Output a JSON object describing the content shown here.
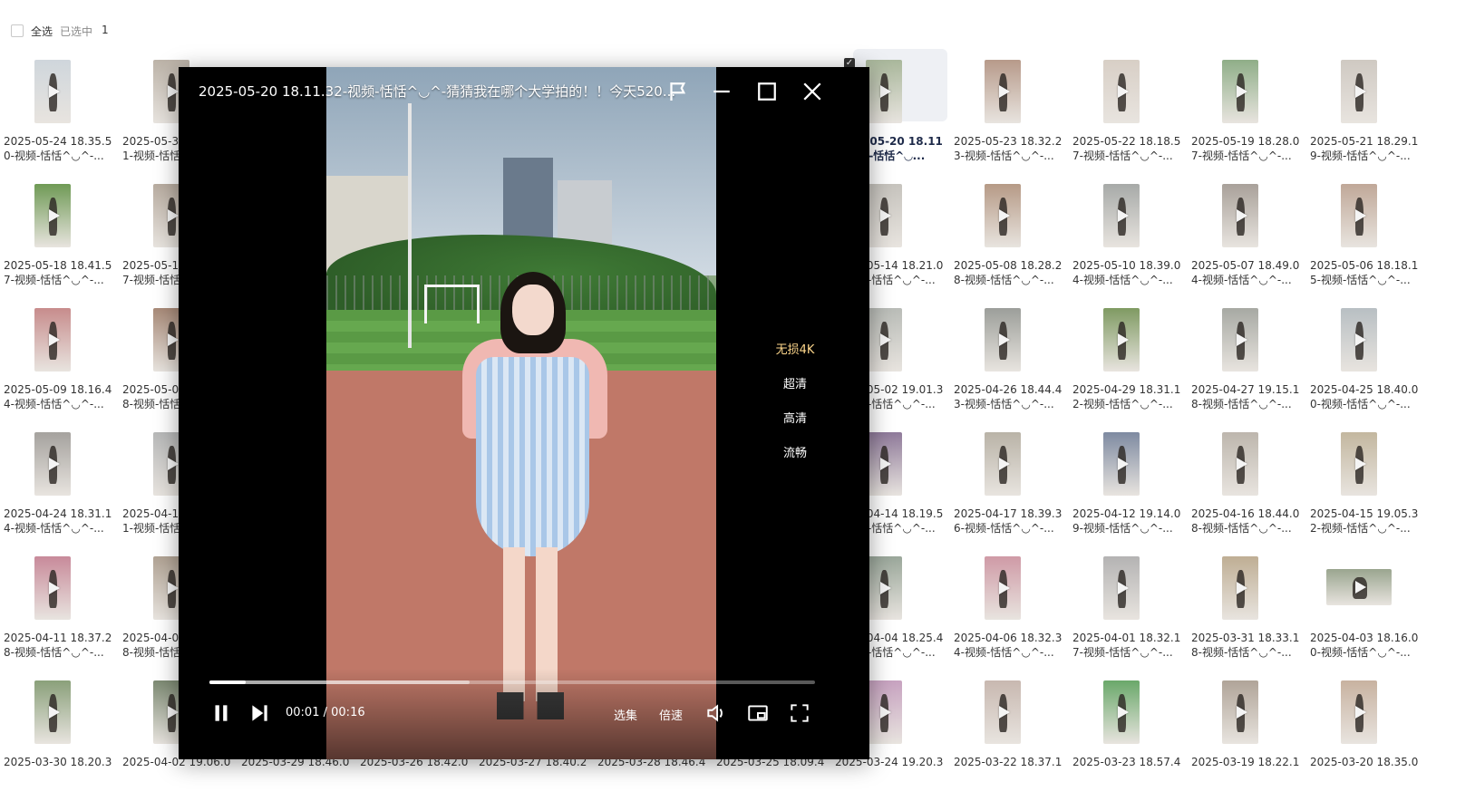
{
  "toolbar": {
    "select_all": "全选",
    "selected_label": "已选中",
    "selected_count": "1"
  },
  "player": {
    "title": "2025-05-20 18.11.32-视频-恬恬^◡^-猜猜我在哪个大学拍的！！今天520...",
    "quality_options": [
      "无损4K",
      "超清",
      "高清",
      "流畅"
    ],
    "active_quality": "无损4K",
    "time_current": "00:01",
    "time_separator": "/",
    "time_total": "00:16",
    "episodes_label": "选集",
    "speed_label": "倍速",
    "progress": 0.06,
    "buffered": 0.43
  },
  "grid": {
    "rows": [
      [
        {
          "l1": "2025-05-24 18.35.5",
          "l2": "0-视频-恬恬^◡^-...",
          "tone": "#cfd6dc"
        },
        {
          "l1": "2025-05-3",
          "l2": "1-视频-恬恬^◡^-...",
          "tone": "#bcb3a8"
        },
        null,
        null,
        null,
        null,
        null,
        {
          "l1": "2025-05-20 18.11.",
          "l2": "2-视频-恬恬^◡...",
          "tone": "#a9b79b",
          "selected": true
        },
        {
          "l1": "2025-05-23 18.32.2",
          "l2": "3-视频-恬恬^◡^-...",
          "tone": "#b79a8a"
        },
        {
          "l1": "2025-05-22 18.18.5",
          "l2": "7-视频-恬恬^◡^-...",
          "tone": "#d8cfc6"
        },
        {
          "l1": "2025-05-19 18.28.0",
          "l2": "7-视频-恬恬^◡^-...",
          "tone": "#8fae88"
        },
        {
          "l1": "2025-05-21 18.29.1",
          "l2": "9-视频-恬恬^◡^-...",
          "tone": "#cfc9c2"
        }
      ],
      [
        {
          "l1": "2025-05-18 18.41.5",
          "l2": "7-视频-恬恬^◡^-...",
          "tone": "#6f9a55"
        },
        {
          "l1": "2025-05-1",
          "l2": "7-视频-恬恬^◡^-...",
          "tone": "#b8aca0"
        },
        null,
        null,
        null,
        null,
        null,
        {
          "l1": "2025-05-14 18.21.0",
          "l2": "4-视频-恬恬^◡^-...",
          "tone": "#c6c3bd"
        },
        {
          "l1": "2025-05-08 18.28.2",
          "l2": "8-视频-恬恬^◡^-...",
          "tone": "#b69a86"
        },
        {
          "l1": "2025-05-10 18.39.0",
          "l2": "4-视频-恬恬^◡^-...",
          "tone": "#a7aaa8"
        },
        {
          "l1": "2025-05-07 18.49.0",
          "l2": "4-视频-恬恬^◡^-...",
          "tone": "#a9a19a"
        },
        {
          "l1": "2025-05-06 18.18.1",
          "l2": "5-视频-恬恬^◡^-...",
          "tone": "#c0a898"
        }
      ],
      [
        {
          "l1": "2025-05-09 18.16.4",
          "l2": "4-视频-恬恬^◡^-...",
          "tone": "#c78c8c"
        },
        {
          "l1": "2025-05-0",
          "l2": "8-视频-恬恬^◡^-...",
          "tone": "#a88a78"
        },
        null,
        null,
        null,
        null,
        null,
        {
          "l1": "2025-05-02 19.01.3",
          "l2": "1-视频-恬恬^◡^-...",
          "tone": "#b9bcb7"
        },
        {
          "l1": "2025-04-26 18.44.4",
          "l2": "3-视频-恬恬^◡^-...",
          "tone": "#9c9e9a"
        },
        {
          "l1": "2025-04-29 18.31.1",
          "l2": "2-视频-恬恬^◡^-...",
          "tone": "#7f9a62"
        },
        {
          "l1": "2025-04-27 19.15.1",
          "l2": "8-视频-恬恬^◡^-...",
          "tone": "#a7a9a3"
        },
        {
          "l1": "2025-04-25 18.40.0",
          "l2": "0-视频-恬恬^◡^-...",
          "tone": "#b8bfc3"
        }
      ],
      [
        {
          "l1": "2025-04-24 18.31.1",
          "l2": "4-视频-恬恬^◡^-...",
          "tone": "#a5a29e"
        },
        {
          "l1": "2025-04-1",
          "l2": "1-视频-恬恬^◡^-...",
          "tone": "#b7b8b8"
        },
        null,
        null,
        null,
        null,
        null,
        {
          "l1": "2025-04-14 18.19.5",
          "l2": "8-视频-恬恬^◡^-...",
          "tone": "#8f7a9a"
        },
        {
          "l1": "2025-04-17 18.39.3",
          "l2": "6-视频-恬恬^◡^-...",
          "tone": "#b9b3a7"
        },
        {
          "l1": "2025-04-12 19.14.0",
          "l2": "9-视频-恬恬^◡^-...",
          "tone": "#7e8aa1"
        },
        {
          "l1": "2025-04-16 18.44.0",
          "l2": "8-视频-恬恬^◡^-...",
          "tone": "#bdb6ad"
        },
        {
          "l1": "2025-04-15 19.05.3",
          "l2": "2-视频-恬恬^◡^-...",
          "tone": "#c3b79f"
        }
      ],
      [
        {
          "l1": "2025-04-11 18.37.2",
          "l2": "8-视频-恬恬^◡^-...",
          "tone": "#c88a9a"
        },
        {
          "l1": "2025-04-0",
          "l2": "8-视频-恬恬^◡^-...",
          "tone": "#b1a394"
        },
        null,
        null,
        null,
        null,
        null,
        {
          "l1": "2025-04-04 18.25.4",
          "l2": "4-视频-恬恬^◡^-...",
          "tone": "#9aa79a"
        },
        {
          "l1": "2025-04-06 18.32.3",
          "l2": "4-视频-恬恬^◡^-...",
          "tone": "#cf9aa6"
        },
        {
          "l1": "2025-04-01 18.32.1",
          "l2": "7-视频-恬恬^◡^-...",
          "tone": "#b4b3b3"
        },
        {
          "l1": "2025-03-31 18.33.1",
          "l2": "8-视频-恬恬^◡^-...",
          "tone": "#bfae94"
        },
        {
          "l1": "2025-04-03 18.16.0",
          "l2": "0-视频-恬恬^◡^-...",
          "tone": "#9aa58f",
          "wide": true
        }
      ],
      [
        {
          "l1": "2025-03-30 18.20.3",
          "l2": "",
          "tone": "#8aa07a"
        },
        {
          "l1": "2025-04-02 19.06.0",
          "l2": "",
          "tone": "#7d8a73"
        },
        {
          "l1": "2025-03-29 18.46.0",
          "l2": "",
          "tone": "#999"
        },
        {
          "l1": "2025-03-26 18.42.0",
          "l2": "",
          "tone": "#999"
        },
        {
          "l1": "2025-03-27 18.40.2",
          "l2": "",
          "tone": "#999"
        },
        {
          "l1": "2025-03-28 18.46.4",
          "l2": "",
          "tone": "#999"
        },
        {
          "l1": "2025-03-25 18.09.4",
          "l2": "",
          "tone": "#999"
        },
        {
          "l1": "2025-03-24 19.20.3",
          "l2": "",
          "tone": "#c7a2c0"
        },
        {
          "l1": "2025-03-22 18.37.1",
          "l2": "",
          "tone": "#c8b8b0"
        },
        {
          "l1": "2025-03-23 18.57.4",
          "l2": "",
          "tone": "#6aa86a"
        },
        {
          "l1": "2025-03-19 18.22.1",
          "l2": "",
          "tone": "#b0a498"
        },
        {
          "l1": "2025-03-20 18.35.0",
          "l2": "",
          "tone": "#c8b2a0"
        }
      ]
    ]
  }
}
